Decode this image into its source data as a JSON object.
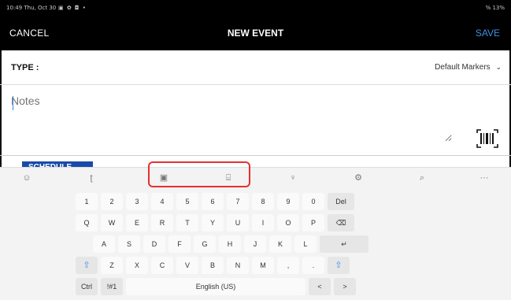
{
  "status": {
    "time": "10:49 Thu, Oct 30",
    "icons": "▣ ✿ ◘ •",
    "battery": "% 13%"
  },
  "header": {
    "cancel": "CANCEL",
    "title": "NEW EVENT",
    "save": "SAVE"
  },
  "type": {
    "label": "TYPE :",
    "value": "Default Markers"
  },
  "notes": {
    "placeholder": "Notes",
    "value": ""
  },
  "schedule": {
    "label": "SCHEDULE"
  },
  "keyboard": {
    "toolbar": [
      "emoji-icon",
      "handwriting-icon",
      "clipboard-icon",
      "one-handed-icon",
      "mic-icon",
      "settings-icon",
      "search-icon",
      "more-icon"
    ],
    "toolbar_glyphs": [
      "☺",
      "ʈ",
      "▣",
      "⌸",
      "♀",
      "⚙",
      "⌕",
      "···"
    ],
    "rows": [
      [
        "1",
        "2",
        "3",
        "4",
        "5",
        "6",
        "7",
        "8",
        "9",
        "0",
        "Del"
      ],
      [
        "Q",
        "W",
        "E",
        "R",
        "T",
        "Y",
        "U",
        "I",
        "O",
        "P",
        "⌫"
      ],
      [
        "A",
        "S",
        "D",
        "F",
        "G",
        "H",
        "J",
        "K",
        "L",
        "↵"
      ],
      [
        "⇧",
        "Z",
        "X",
        "C",
        "V",
        "B",
        "N",
        "M",
        ",",
        ".",
        "⇧"
      ],
      [
        "Ctrl",
        "!#1",
        "English (US)",
        "<",
        ">"
      ]
    ]
  },
  "colors": {
    "accent": "#3f8fe0",
    "highlight": "#e53030",
    "schedule_bg": "#1a4aa8"
  }
}
